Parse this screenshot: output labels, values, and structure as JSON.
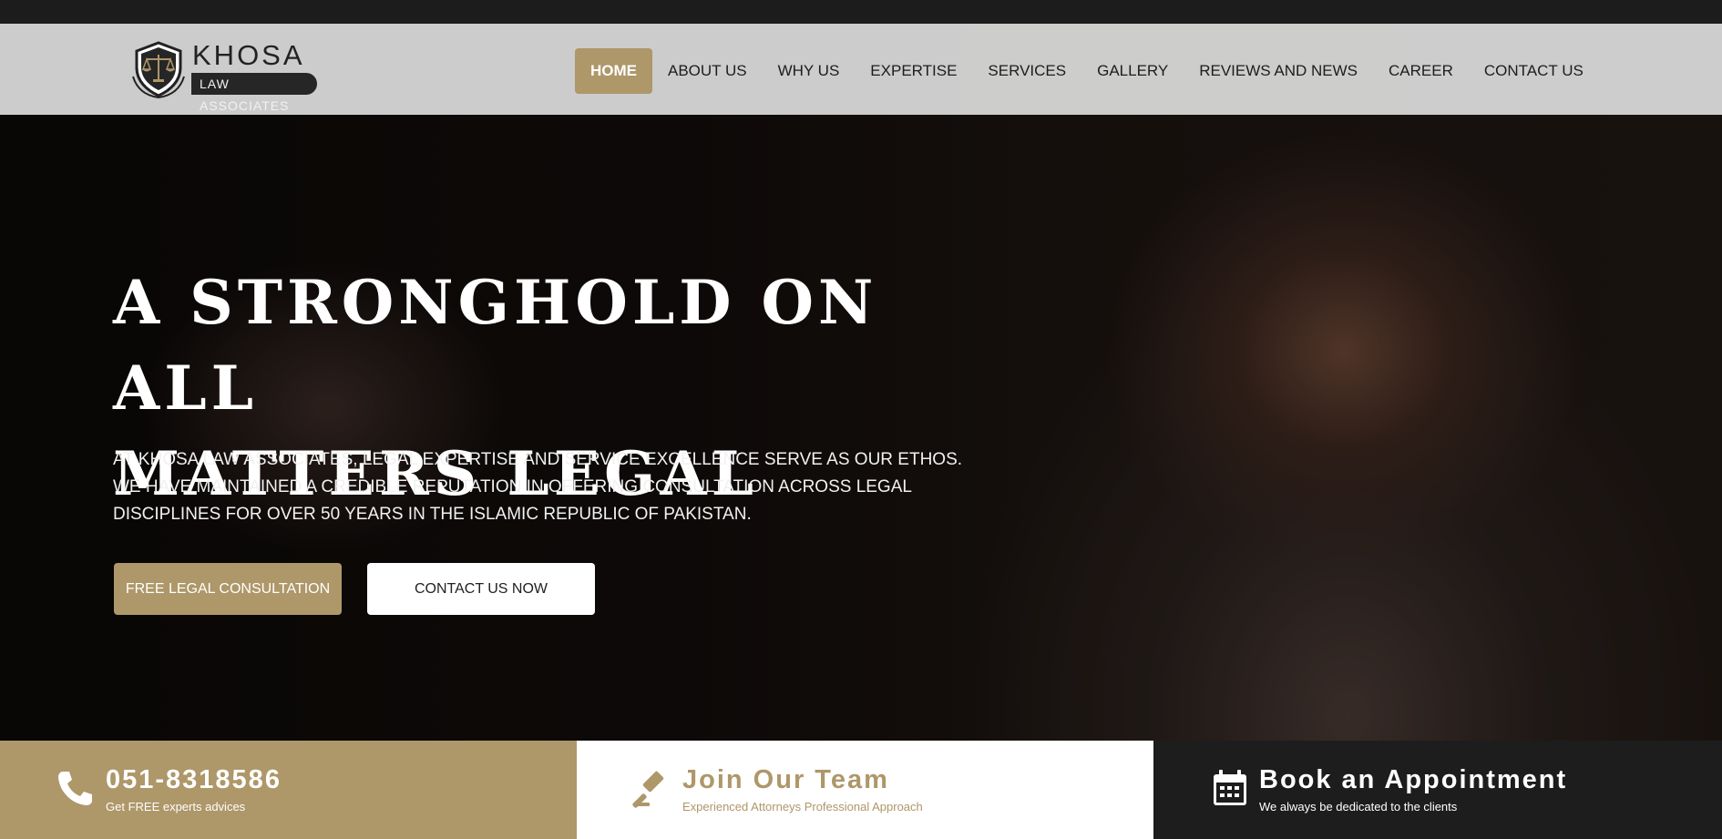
{
  "brand": {
    "name": "KHOSA",
    "subtitle": "LAW ASSOCIATES"
  },
  "nav": {
    "items": [
      {
        "label": "HOME",
        "active": true
      },
      {
        "label": "ABOUT US"
      },
      {
        "label": "WHY US"
      },
      {
        "label": "EXPERTISE"
      },
      {
        "label": "SERVICES"
      },
      {
        "label": "GALLERY"
      },
      {
        "label": "REVIEWS AND NEWS"
      },
      {
        "label": "CAREER"
      },
      {
        "label": "CONTACT US"
      }
    ]
  },
  "hero": {
    "headline_line1": "A STRONGHOLD ON ALL",
    "headline_line2": "MATTERS LEGAL",
    "intro": "AT KHOSA LAW ASSOCIATES, LEGAL EXPERTISE AND SERVICE EXCELLENCE SERVE AS OUR ETHOS. WE HAVE MAINTAINED A CREDIBLE REPUTATION IN OFFERING CONSULTATION ACROSS LEGAL DISCIPLINES FOR OVER 50 YEARS IN THE ISLAMIC REPUBLIC OF PAKISTAN.",
    "primary_button": "FREE LEGAL CONSULTATION",
    "secondary_button": "CONTACT US NOW"
  },
  "bottom_bar": {
    "phone": {
      "title": "051-8318586",
      "subtitle": "Get FREE experts advices",
      "icon": "phone-icon"
    },
    "team": {
      "title": "Join Our Team",
      "subtitle": "Experienced Attorneys Professional Approach",
      "icon": "gavel-icon"
    },
    "appointment": {
      "title": "Book an Appointment",
      "subtitle": "We always be dedicated to the clients",
      "icon": "calendar-icon"
    }
  },
  "colors": {
    "accent": "#ae9769",
    "dark": "#1d1d1d",
    "header_bg": "#dcdcdc",
    "white": "#ffffff"
  }
}
